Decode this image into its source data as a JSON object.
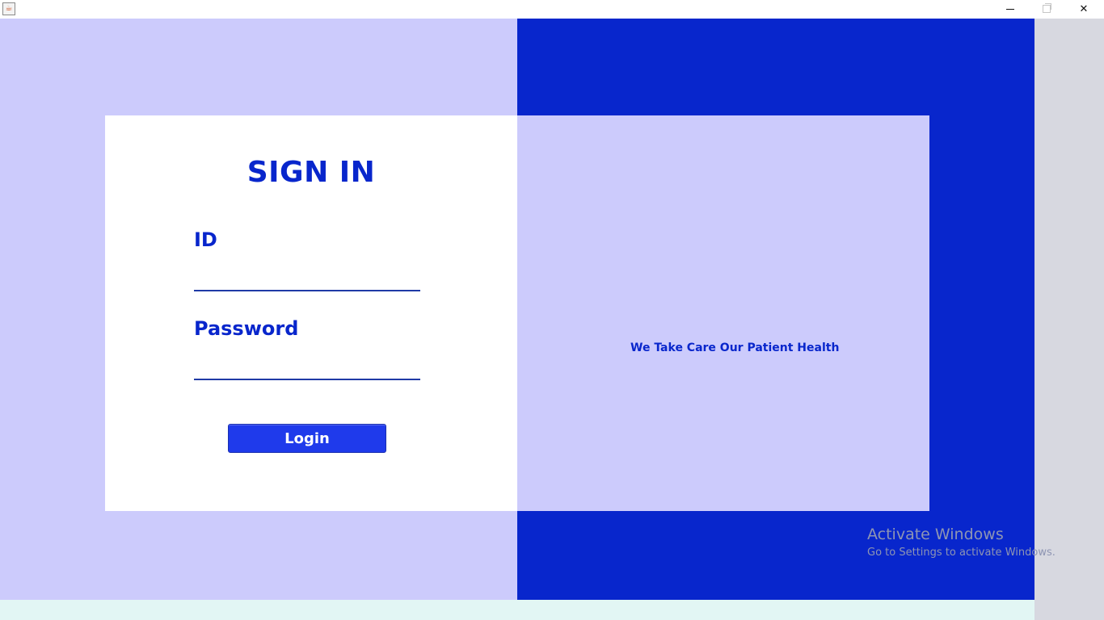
{
  "window": {
    "app_icon": "java-icon",
    "minimize_icon": "minimize-icon",
    "maximize_icon": "maximize-icon",
    "close_icon": "close-icon"
  },
  "login": {
    "title": "SIGN IN",
    "id_label": "ID",
    "id_value": "",
    "password_label": "Password",
    "password_value": "",
    "button_label": "Login"
  },
  "banner": {
    "tagline": "We Take Care Our Patient Health"
  },
  "watermark": {
    "title": "Activate Windows",
    "subtitle": "Go to Settings to activate Windows."
  },
  "colors": {
    "primary": "#0826cc",
    "light_panel": "#cccbfc",
    "button": "#1f3aeb"
  }
}
